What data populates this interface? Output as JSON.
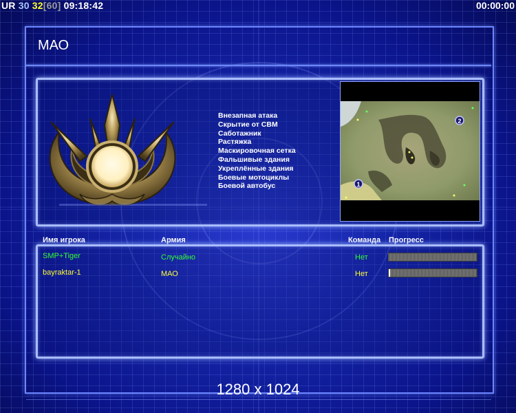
{
  "hud": {
    "ur_label": "UR",
    "ur_value": "30",
    "fps_value": "32",
    "fps_limit": "[60]",
    "clock": "09:18:42",
    "timer": "00:00:00"
  },
  "title": "МАО",
  "features": [
    "Внезапная атака",
    "Скрытие от СВМ",
    "Саботажник",
    "Растяжка",
    "Маскировочная сетка",
    "Фальшивые здания",
    "Укреплённые здания",
    "Боевые мотоциклы",
    "Боевой автобус"
  ],
  "minimap": {
    "start_positions": [
      "1",
      "2"
    ]
  },
  "players_table": {
    "headers": {
      "name": "Имя игрока",
      "army": "Армия",
      "team": "Команда",
      "progress": "Прогресс"
    },
    "rows": [
      {
        "name": "SMP+Tiger",
        "army": "Случайно",
        "team": "Нет",
        "progress": 0.0,
        "color": "#33ff33"
      },
      {
        "name": "bayraktar-1",
        "army": "МАО",
        "team": "Нет",
        "progress": 0.01,
        "color": "#ffff33"
      }
    ]
  },
  "resolution": "1280 x 1024",
  "colors": {
    "hud_ur": "#ffffff",
    "hud_ur_value": "#a9c8ff",
    "hud_fps": "#ffff33",
    "hud_fps_limit": "#9a9a9a",
    "panel_border": "#a9bcff",
    "background": "#1525a8"
  }
}
